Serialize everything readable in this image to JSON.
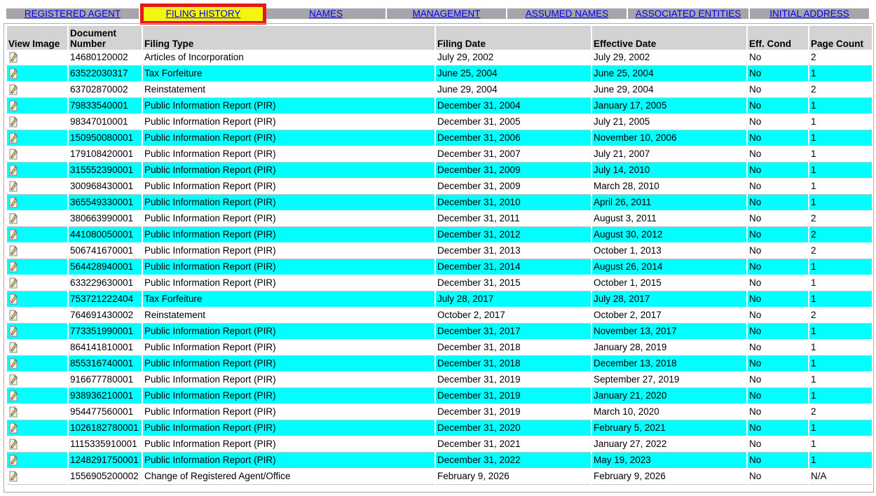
{
  "tabs": [
    {
      "label": "REGISTERED AGENT"
    },
    {
      "label": "FILING HISTORY",
      "active": true
    },
    {
      "label": "NAMES"
    },
    {
      "label": "MANAGEMENT"
    },
    {
      "label": "ASSUMED NAMES"
    },
    {
      "label": "ASSOCIATED ENTITIES"
    },
    {
      "label": "INITIAL ADDRESS"
    }
  ],
  "table": {
    "headers": {
      "view_image": "View Image",
      "document_number": "Document Number",
      "filing_type": "Filing Type",
      "filing_date": "Filing Date",
      "effective_date": "Effective Date",
      "eff_cond": "Eff. Cond",
      "page_count": "Page Count"
    },
    "view_image_icon": "document-pen-icon",
    "rows": [
      {
        "doc": "14680120002",
        "type": "Articles of Incorporation",
        "filing_date": "July 29, 2002",
        "effective_date": "July 29, 2002",
        "eff_cond": "No",
        "pages": "2"
      },
      {
        "doc": "63522030317",
        "type": "Tax Forfeiture",
        "filing_date": "June 25, 2004",
        "effective_date": "June 25, 2004",
        "eff_cond": "No",
        "pages": "1"
      },
      {
        "doc": "63702870002",
        "type": "Reinstatement",
        "filing_date": "June 29, 2004",
        "effective_date": "June 29, 2004",
        "eff_cond": "No",
        "pages": "2"
      },
      {
        "doc": "79833540001",
        "type": "Public Information Report (PIR)",
        "filing_date": "December 31, 2004",
        "effective_date": "January 17, 2005",
        "eff_cond": "No",
        "pages": "1"
      },
      {
        "doc": "98347010001",
        "type": "Public Information Report (PIR)",
        "filing_date": "December 31, 2005",
        "effective_date": "July 21, 2005",
        "eff_cond": "No",
        "pages": "1"
      },
      {
        "doc": "150950080001",
        "type": "Public Information Report (PIR)",
        "filing_date": "December 31, 2006",
        "effective_date": "November 10, 2006",
        "eff_cond": "No",
        "pages": "1"
      },
      {
        "doc": "179108420001",
        "type": "Public Information Report (PIR)",
        "filing_date": "December 31, 2007",
        "effective_date": "July 21, 2007",
        "eff_cond": "No",
        "pages": "1"
      },
      {
        "doc": "315552390001",
        "type": "Public Information Report (PIR)",
        "filing_date": "December 31, 2009",
        "effective_date": "July 14, 2010",
        "eff_cond": "No",
        "pages": "1"
      },
      {
        "doc": "300968430001",
        "type": "Public Information Report (PIR)",
        "filing_date": "December 31, 2009",
        "effective_date": "March 28, 2010",
        "eff_cond": "No",
        "pages": "1"
      },
      {
        "doc": "365549330001",
        "type": "Public Information Report (PIR)",
        "filing_date": "December 31, 2010",
        "effective_date": "April 26, 2011",
        "eff_cond": "No",
        "pages": "1"
      },
      {
        "doc": "380663990001",
        "type": "Public Information Report (PIR)",
        "filing_date": "December 31, 2011",
        "effective_date": "August 3, 2011",
        "eff_cond": "No",
        "pages": "2"
      },
      {
        "doc": "441080050001",
        "type": "Public Information Report (PIR)",
        "filing_date": "December 31, 2012",
        "effective_date": "August 30, 2012",
        "eff_cond": "No",
        "pages": "2"
      },
      {
        "doc": "506741670001",
        "type": "Public Information Report (PIR)",
        "filing_date": "December 31, 2013",
        "effective_date": "October 1, 2013",
        "eff_cond": "No",
        "pages": "2"
      },
      {
        "doc": "564428940001",
        "type": "Public Information Report (PIR)",
        "filing_date": "December 31, 2014",
        "effective_date": "August 26, 2014",
        "eff_cond": "No",
        "pages": "1"
      },
      {
        "doc": "633229630001",
        "type": "Public Information Report (PIR)",
        "filing_date": "December 31, 2015",
        "effective_date": "October 1, 2015",
        "eff_cond": "No",
        "pages": "1"
      },
      {
        "doc": "753721222404",
        "type": "Tax Forfeiture",
        "filing_date": "July 28, 2017",
        "effective_date": "July 28, 2017",
        "eff_cond": "No",
        "pages": "1"
      },
      {
        "doc": "764691430002",
        "type": "Reinstatement",
        "filing_date": "October 2, 2017",
        "effective_date": "October 2, 2017",
        "eff_cond": "No",
        "pages": "2"
      },
      {
        "doc": "773351990001",
        "type": "Public Information Report (PIR)",
        "filing_date": "December 31, 2017",
        "effective_date": "November 13, 2017",
        "eff_cond": "No",
        "pages": "1"
      },
      {
        "doc": "864141810001",
        "type": "Public Information Report (PIR)",
        "filing_date": "December 31, 2018",
        "effective_date": "January 28, 2019",
        "eff_cond": "No",
        "pages": "1"
      },
      {
        "doc": "855316740001",
        "type": "Public Information Report (PIR)",
        "filing_date": "December 31, 2018",
        "effective_date": "December 13, 2018",
        "eff_cond": "No",
        "pages": "1"
      },
      {
        "doc": "916677780001",
        "type": "Public Information Report (PIR)",
        "filing_date": "December 31, 2019",
        "effective_date": "September 27, 2019",
        "eff_cond": "No",
        "pages": "1"
      },
      {
        "doc": "938936210001",
        "type": "Public Information Report (PIR)",
        "filing_date": "December 31, 2019",
        "effective_date": "January 21, 2020",
        "eff_cond": "No",
        "pages": "1"
      },
      {
        "doc": "954477560001",
        "type": "Public Information Report (PIR)",
        "filing_date": "December 31, 2019",
        "effective_date": "March 10, 2020",
        "eff_cond": "No",
        "pages": "2"
      },
      {
        "doc": "1026182780001",
        "type": "Public Information Report (PIR)",
        "filing_date": "December 31, 2020",
        "effective_date": "February 5, 2021",
        "eff_cond": "No",
        "pages": "1"
      },
      {
        "doc": "1115335910001",
        "type": "Public Information Report (PIR)",
        "filing_date": "December 31, 2021",
        "effective_date": "January 27, 2022",
        "eff_cond": "No",
        "pages": "1"
      },
      {
        "doc": "1248291750001",
        "type": "Public Information Report (PIR)",
        "filing_date": "December 31, 2022",
        "effective_date": "May 19, 2023",
        "eff_cond": "No",
        "pages": "1"
      },
      {
        "doc": "1556905200002",
        "type": "Change of Registered Agent/Office",
        "filing_date": "February 9, 2026",
        "effective_date": "February 9, 2026",
        "eff_cond": "No",
        "pages": "N/A"
      }
    ]
  },
  "colors": {
    "tab_bg": "#a8a4ac",
    "active_tab_bg": "#f5f512",
    "active_tab_border": "#e81818",
    "row_alt": "#00ffff",
    "header_bg": "#d3d3d3",
    "link": "#0000ee"
  }
}
